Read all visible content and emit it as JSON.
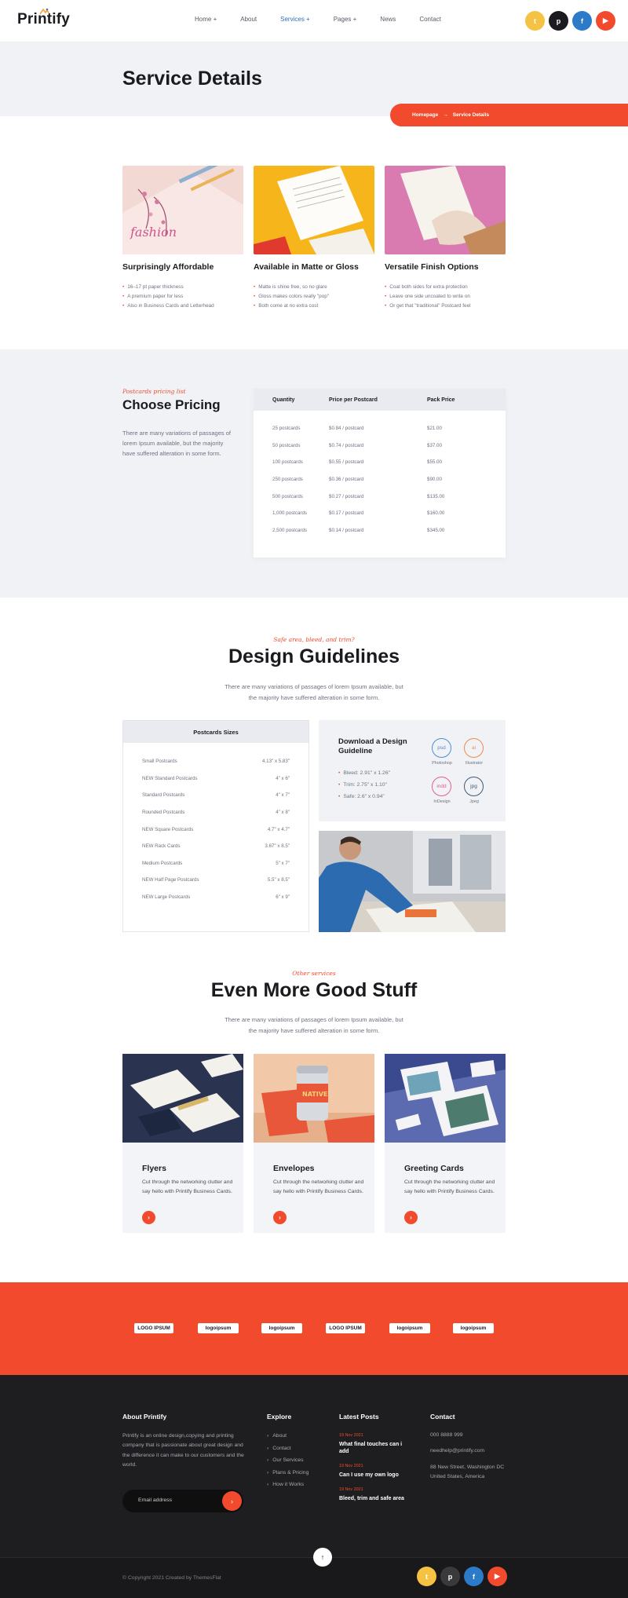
{
  "brand": {
    "name": "Printify"
  },
  "nav": {
    "items": [
      "Home +",
      "About",
      "Services +",
      "Pages +",
      "News",
      "Contact"
    ],
    "active": "Services +"
  },
  "socials": [
    {
      "icon": "twitter-icon",
      "glyph": "t",
      "color": "#f6c244"
    },
    {
      "icon": "pinterest-icon",
      "glyph": "p",
      "color": "#1b1b1f"
    },
    {
      "icon": "facebook-icon",
      "glyph": "f",
      "color": "#2b7bc8"
    },
    {
      "icon": "youtube-icon",
      "glyph": "▶",
      "color": "#f24a2c"
    }
  ],
  "hero": {
    "title": "Service Details",
    "crumb_home": "Homepage",
    "crumb_sep": "→",
    "crumb_current": "Service Details"
  },
  "features": [
    {
      "title": "Surprisingly Affordable",
      "points": [
        "16–17 pt paper thickness",
        "A premium paper for less",
        "Also in Business Cards and Letterhead"
      ]
    },
    {
      "title": "Available in Matte or Gloss",
      "points": [
        "Matte is shine free, so no glare",
        "Gloss makes colors really \"pop\"",
        "Both come at no extra cost"
      ]
    },
    {
      "title": "Versatile Finish Options",
      "points": [
        "Coat both sides for extra protection",
        "Leave one side uncoated to write on",
        "Or get that \"traditional\" Postcard feel"
      ]
    }
  ],
  "pricing": {
    "script": "Postcards pricing list",
    "title": "Choose Pricing",
    "text": "There are many variations of passages of lorem Ipsum available, but the majority have suffered alteration in some form.",
    "headers": [
      "Quantity",
      "Price per Postcard",
      "Pack Price"
    ],
    "rows": [
      [
        "25 postcards",
        "$0.84 / postcard",
        "$21.00"
      ],
      [
        "50 postcards",
        "$0.74 / postcard",
        "$37.00"
      ],
      [
        "100 postcards",
        "$0.55 / postcard",
        "$55.00"
      ],
      [
        "250 postcards",
        "$0.36 / postcard",
        "$90.00"
      ],
      [
        "500 postcards",
        "$0.27 / postcard",
        "$135.00"
      ],
      [
        "1,000 postcards",
        "$0.17 / postcard",
        "$160.00"
      ],
      [
        "2,500 postcards",
        "$0.14 / postcard",
        "$345.00"
      ]
    ]
  },
  "guidelines": {
    "script": "Safe area, bleed, and trim?",
    "title": "Design Guidelines",
    "text_line1": "There are many variations of passages of lorem Ipsum available, but",
    "text_line2": "the majority have suffered alteration in some form.",
    "sizes_title": "Postcards Sizes",
    "sizes": [
      [
        "Small Postcards",
        "4.13\" x 5.83\""
      ],
      [
        "NEW Standard Postcards",
        "4\" x 6\""
      ],
      [
        "Standard Postcards",
        "4\" x 7\""
      ],
      [
        "Rounded Postcards",
        "4\" x 8\""
      ],
      [
        "NEW Square Postcards",
        "4.7\" x 4.7\""
      ],
      [
        "NEW Rack Cards",
        "3.67\" x 8.5\""
      ],
      [
        "Medium Postcards",
        "5\" x 7\""
      ],
      [
        "NEW Half Page Postcards",
        "5.5\" x 8.5\""
      ],
      [
        "NEW Large Postcards",
        "6\" x 9\""
      ]
    ],
    "download_title": "Download a Design Guideline",
    "download_points": [
      "Bleed: 2.91\" x 1.26\"",
      "Trim: 2.75\" x 1.10\"",
      "Safe: 2.6\" x 0.94\""
    ],
    "formats": [
      {
        "abbr": "psd",
        "label": "Photoshop",
        "color": "#4a8fd6"
      },
      {
        "abbr": "ai",
        "label": "Illustrator",
        "color": "#f08a4b"
      },
      {
        "abbr": "indd",
        "label": "InDesign",
        "color": "#e0608a"
      },
      {
        "abbr": "jpg",
        "label": "Jpeg",
        "color": "#3d5a73"
      }
    ]
  },
  "services": {
    "script": "Other services",
    "title": "Even More Good Stuff",
    "text_line1": "There are many variations of passages of lorem Ipsum available, but",
    "text_line2": "the majority have suffered alteration in some form.",
    "items": [
      {
        "title": "Flyers",
        "text": "Cut through the networking clutter and say hello with Printify Business Cards."
      },
      {
        "title": "Envelopes",
        "text": "Cut through the networking clutter and say hello with Printify Business Cards."
      },
      {
        "title": "Greeting Cards",
        "text": "Cut through the networking clutter and say hello with Printify Business Cards."
      }
    ]
  },
  "partner_logos": [
    "LOGO IPSUM",
    "logoipsum",
    "logoipsum",
    "LOGO IPSUM",
    "logoipsum",
    "logoipsum"
  ],
  "footer": {
    "about_title": "About Printify",
    "about_text": "Printify is an online design,copying and printing company that is passionate about great design and the difference it can make to our customers and the world.",
    "email_placeholder": "Email address",
    "explore_title": "Explore",
    "explore": [
      "About",
      "Contact",
      "Our Services",
      "Plans & Pricing",
      "How it Works"
    ],
    "posts_title": "Latest Posts",
    "posts": [
      {
        "date": "19 Nov 2021",
        "title": "What final touches can i add"
      },
      {
        "date": "19 Nov 2021",
        "title": "Can I use my own logo"
      },
      {
        "date": "19 Nov 2021",
        "title": "Bleed, trim and safe area"
      }
    ],
    "contact_title": "Contact",
    "phone": "000 8888 999",
    "email": "needhelp@printify.com",
    "address": "88 New Street, Washington DC United States, America",
    "copyright": "© Copyright 2021 Created by ThemesFlat"
  }
}
